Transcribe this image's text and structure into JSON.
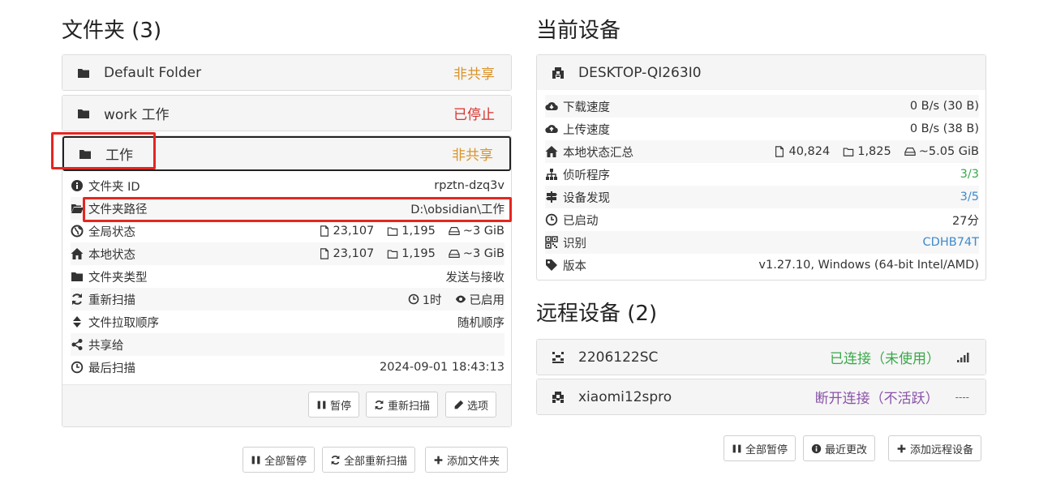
{
  "folders": {
    "heading": "文件夹 (3)",
    "items": [
      {
        "name": "Default Folder",
        "status": "非共享"
      },
      {
        "name": "work 工作",
        "status": "已停止"
      },
      {
        "name": "工作",
        "status": "非共享"
      }
    ],
    "details": {
      "id_label": "文件夹 ID",
      "id_value": "rpztn-dzq3v",
      "path_label": "文件夹路径",
      "path_value": "D:\\obsidian\\工作",
      "global_label": "全局状态",
      "global_files": "23,107",
      "global_dirs": "1,195",
      "global_size": "~3 GiB",
      "local_label": "本地状态",
      "local_files": "23,107",
      "local_dirs": "1,195",
      "local_size": "~3 GiB",
      "type_label": "文件夹类型",
      "type_value": "发送与接收",
      "rescan_label": "重新扫描",
      "rescan_interval": "1时",
      "rescan_watch": "已启用",
      "order_label": "文件拉取顺序",
      "order_value": "随机顺序",
      "shared_label": "共享给",
      "shared_value": "",
      "lastscan_label": "最后扫描",
      "lastscan_value": "2024-09-01 18:43:13"
    },
    "buttons": {
      "pause": "暂停",
      "rescan": "重新扫描",
      "options": "选项"
    },
    "bottom_buttons": {
      "pause_all": "全部暂停",
      "rescan_all": "全部重新扫描",
      "add_folder": "添加文件夹"
    }
  },
  "device": {
    "heading": "当前设备",
    "name": "DESKTOP-QI263I0",
    "rows": {
      "down_label": "下载速度",
      "down_value": "0 B/s (30 B)",
      "up_label": "上传速度",
      "up_value": "0 B/s (38 B)",
      "local_label": "本地状态汇总",
      "local_files": "40,824",
      "local_dirs": "1,825",
      "local_size": "~5.05 GiB",
      "listen_label": "侦听程序",
      "listen_value": "3/3",
      "discovery_label": "设备发现",
      "discovery_value": "3/5",
      "uptime_label": "已启动",
      "uptime_value": "27分",
      "id_label": "识别",
      "id_value": "CDHB74T",
      "version_label": "版本",
      "version_value": "v1.27.10, Windows (64-bit Intel/AMD)"
    }
  },
  "remote": {
    "heading": "远程设备 (2)",
    "items": [
      {
        "name": "2206122SC",
        "status": "已连接（未使用）",
        "extra": ""
      },
      {
        "name": "xiaomi12spro",
        "status": "断开连接（不活跃）",
        "extra": "----"
      }
    ],
    "bottom_buttons": {
      "pause_all": "全部暂停",
      "recent": "最近更改",
      "add_remote": "添加远程设备"
    }
  },
  "colors": {
    "warning": "#d9942b",
    "danger": "#d9312c",
    "success": "#3aa84a",
    "purple": "#8a53a8",
    "link": "#3e8acc",
    "highlight": "#e52620"
  }
}
